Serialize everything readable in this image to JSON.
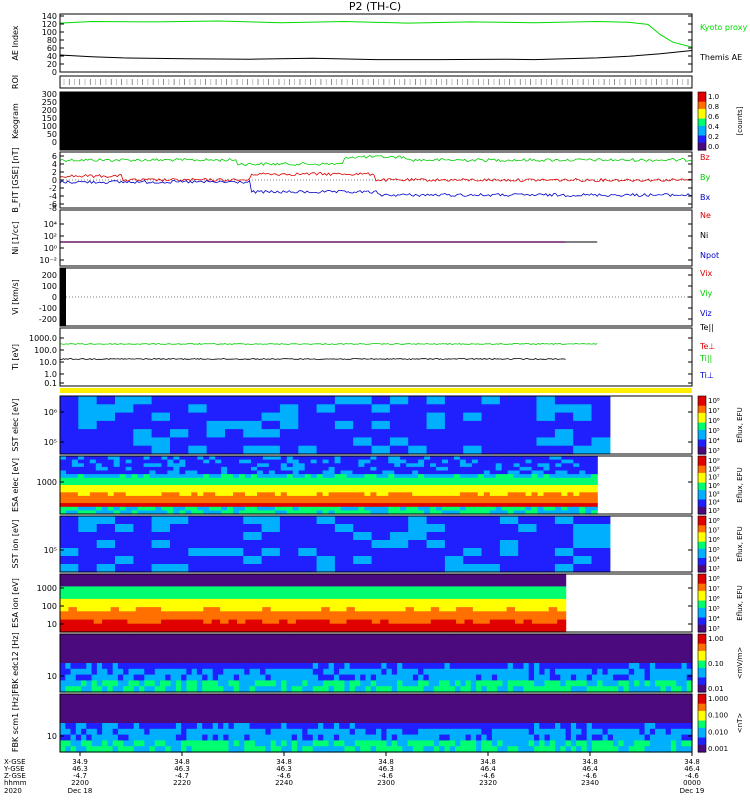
{
  "title": "P2 (TH-C)",
  "chart_data": [
    {
      "id": "ae",
      "type": "line",
      "ylabel": "AE Index",
      "yticks": [
        "140",
        "120",
        "100",
        "80",
        "60",
        "40",
        "20",
        "0"
      ],
      "ylim": [
        0,
        140
      ],
      "series": [
        {
          "name": "Kyoto proxy AE",
          "color": "#00dd00",
          "x": [
            0,
            0.05,
            0.15,
            0.25,
            0.35,
            0.45,
            0.55,
            0.65,
            0.75,
            0.85,
            0.9,
            0.93,
            0.95,
            0.97,
            1.0
          ],
          "values": [
            118,
            122,
            121,
            123,
            119,
            122,
            118,
            121,
            119,
            122,
            120,
            115,
            90,
            72,
            60
          ]
        },
        {
          "name": "Themis AE",
          "color": "#000000",
          "x": [
            0,
            0.05,
            0.1,
            0.2,
            0.3,
            0.4,
            0.5,
            0.6,
            0.7,
            0.75,
            0.8,
            0.85,
            0.9,
            0.95,
            1.0
          ],
          "values": [
            41,
            37,
            34,
            32,
            31,
            33,
            30,
            30,
            31,
            30,
            32,
            34,
            38,
            44,
            52
          ]
        }
      ]
    },
    {
      "id": "roi",
      "type": "other",
      "ylabel": "ROI"
    },
    {
      "id": "keogram",
      "type": "heatmap",
      "ylabel": "Keogram",
      "yticks": [
        "300",
        "250",
        "200",
        "150",
        "100",
        "50",
        "0"
      ],
      "colorbar": {
        "label": "[counts]",
        "ticks": [
          "1.0",
          "0.8",
          "0.6",
          "0.4",
          "0.2",
          "0.0"
        ]
      }
    },
    {
      "id": "bfield",
      "type": "line",
      "ylabel": "B_FIT [GSE] [nT]",
      "yticks": [
        "6",
        "4",
        "2",
        "0",
        "-2",
        "-4",
        "-6",
        "-8"
      ],
      "ylim": [
        -8,
        6
      ],
      "series": [
        {
          "name": "Bz",
          "color": "#dd0000"
        },
        {
          "name": "By",
          "color": "#00cc00"
        },
        {
          "name": "Bx",
          "color": "#0000cc"
        }
      ]
    },
    {
      "id": "density",
      "type": "line",
      "ylabel": "Ni [1/cc]",
      "yticks": [
        "10⁴",
        "10²",
        "10⁰",
        "10⁻²"
      ],
      "series": [
        {
          "name": "Ne",
          "color": "#dd0000"
        },
        {
          "name": "Ni",
          "color": "#000000"
        },
        {
          "name": "Npot",
          "color": "#0000cc"
        }
      ]
    },
    {
      "id": "velocity",
      "type": "line",
      "ylabel": "Vi [km/s]",
      "yticks": [
        "200",
        "100",
        "0",
        "-100",
        "-200"
      ],
      "series": [
        {
          "name": "Vix",
          "color": "#dd0000"
        },
        {
          "name": "Viy",
          "color": "#00cc00"
        },
        {
          "name": "Viz",
          "color": "#0000cc"
        },
        {
          "name": "Te||",
          "color": "#000000"
        }
      ]
    },
    {
      "id": "temperature",
      "type": "line",
      "ylabel": "Ti [eV]",
      "yticks": [
        "1000.0",
        "100.0",
        "10.0",
        "1.0",
        "0.1"
      ],
      "series": [
        {
          "name": "Te⊥",
          "color": "#dd0000"
        },
        {
          "name": "Ti||",
          "color": "#00cc00"
        },
        {
          "name": "Ti⊥",
          "color": "#0000cc"
        }
      ]
    },
    {
      "id": "sst_e",
      "type": "heatmap",
      "ylabel": "SST elec [eV]",
      "yticks": [
        "10⁶",
        "10⁵"
      ],
      "colorbar": {
        "label": "Eflux, EFU",
        "ticks": [
          "10⁸",
          "10⁷",
          "10⁶",
          "10⁵",
          "10⁴",
          "10³"
        ]
      }
    },
    {
      "id": "esa_e",
      "type": "heatmap",
      "ylabel": "ESA elec [eV]",
      "yticks": [
        "1000"
      ],
      "colorbar": {
        "label": "Eflux, EFU",
        "ticks": [
          "10⁹",
          "10⁸",
          "10⁷",
          "10⁶",
          "10⁵",
          "10⁴",
          "10³"
        ]
      }
    },
    {
      "id": "sst_i",
      "type": "heatmap",
      "ylabel": "SST ion [eV]",
      "yticks": [
        "10⁵"
      ],
      "colorbar": {
        "label": "Eflux, EFU",
        "ticks": [
          "10⁸",
          "10⁷",
          "10⁶",
          "10⁵",
          "10⁴",
          "10³"
        ]
      }
    },
    {
      "id": "esa_i",
      "type": "heatmap",
      "ylabel": "ESA ion [eV]",
      "yticks": [
        "1000",
        "100",
        "10"
      ],
      "colorbar": {
        "label": "Eflux, EFU",
        "ticks": [
          "10⁸",
          "10⁷",
          "10⁶",
          "10⁵",
          "10⁴",
          "10³"
        ]
      }
    },
    {
      "id": "fbk_b",
      "type": "heatmap",
      "ylabel": "FBK edc12 [Hz]",
      "yticks": [
        "10"
      ],
      "colorbar": {
        "label": "<mV/m>",
        "ticks": [
          "1.00",
          "0.10",
          "0.01"
        ]
      }
    },
    {
      "id": "fbk_s",
      "type": "heatmap",
      "ylabel": "FBK scm1 [Hz]",
      "yticks": [
        "10"
      ],
      "colorbar": {
        "label": "<nT>",
        "ticks": [
          "1.000",
          "0.100",
          "0.010",
          "0.001"
        ]
      }
    }
  ],
  "x_axis": {
    "row_labels": [
      "X-GSE",
      "Y-GSE",
      "Z-GSE",
      "hhmm",
      "2020"
    ],
    "ticks": [
      {
        "x": "34.9",
        "y": "46.3",
        "z": "-4.7",
        "hhmm": "2200",
        "date": "Dec 18"
      },
      {
        "x": "34.8",
        "y": "46.3",
        "z": "-4.7",
        "hhmm": "2220",
        "date": ""
      },
      {
        "x": "34.8",
        "y": "46.3",
        "z": "-4.6",
        "hhmm": "2240",
        "date": ""
      },
      {
        "x": "34.8",
        "y": "46.3",
        "z": "-4.6",
        "hhmm": "2300",
        "date": ""
      },
      {
        "x": "34.8",
        "y": "46.4",
        "z": "-4.6",
        "hhmm": "2320",
        "date": ""
      },
      {
        "x": "34.8",
        "y": "46.4",
        "z": "-4.6",
        "hhmm": "2340",
        "date": ""
      },
      {
        "x": "34.8",
        "y": "46.4",
        "z": "-4.6",
        "hhmm": "0000",
        "date": "Dec 19"
      }
    ]
  }
}
